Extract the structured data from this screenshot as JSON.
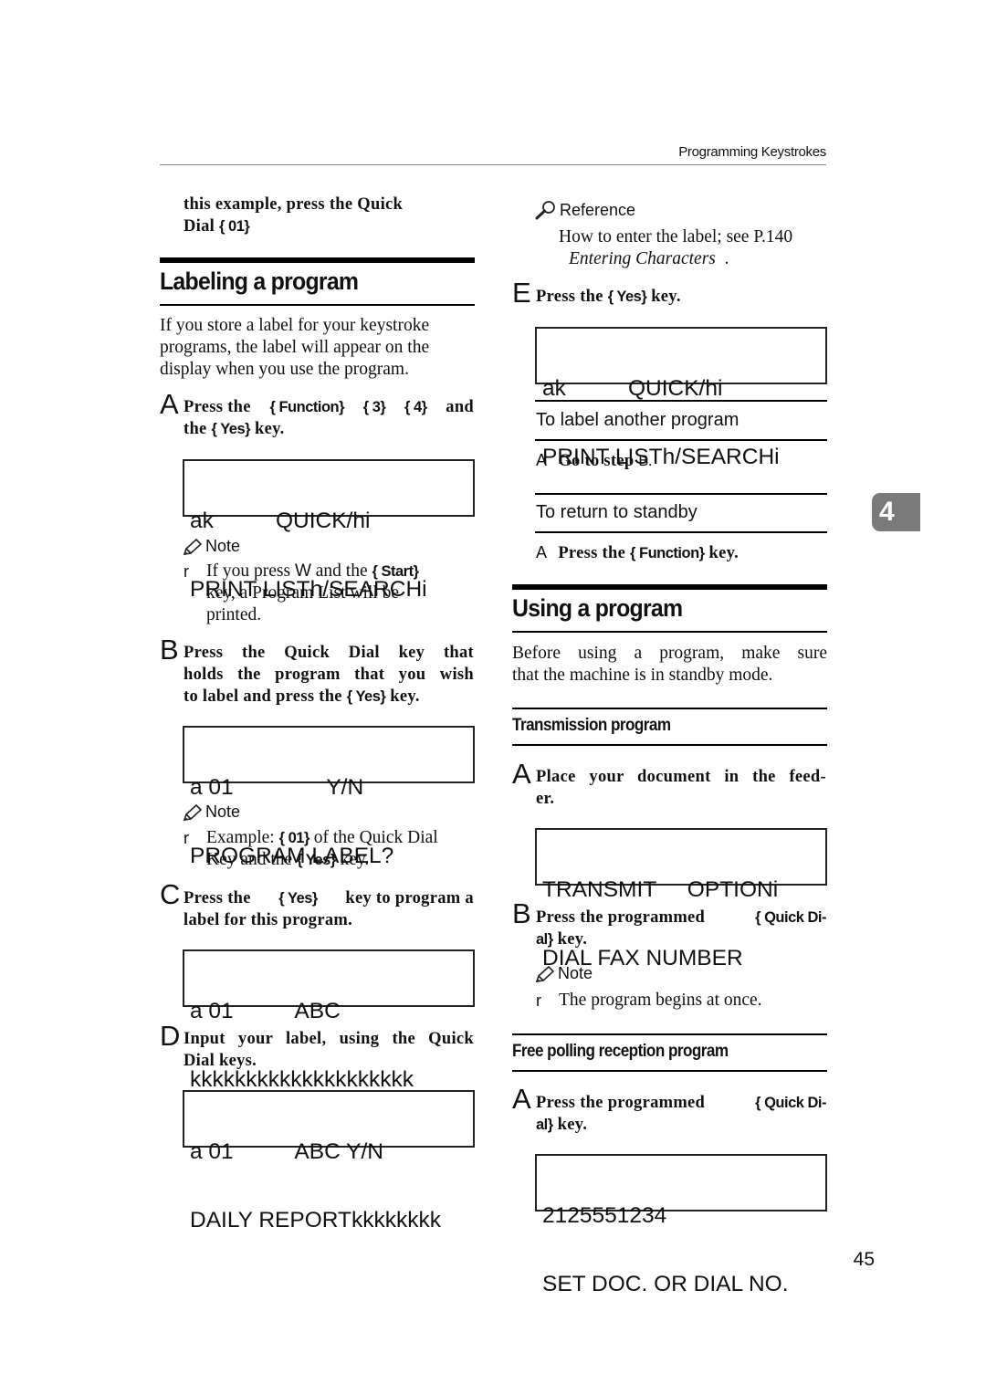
{
  "header": {
    "running_head": "Programming Keystrokes"
  },
  "left": {
    "intro": {
      "line1": "this example, press the Quick",
      "line2_prefix": "Dial ",
      "line2_key": "{ 01}"
    },
    "section_title": "Labeling a program",
    "section_body": [
      "If you store a label for your keystroke",
      "programs, the label will appear on the",
      "display when you use the program."
    ],
    "steps": [
      {
        "letter": "A",
        "parts": [
          "Press the ",
          "{ Function}",
          " ",
          "{ 3}",
          " ",
          "{ 4}",
          " and",
          "the ",
          "{ Yes}",
          " key."
        ],
        "display": [
          "ak          QUICK/hi",
          "PRINT LISTh/SEARCHi"
        ],
        "note": {
          "title": "Note",
          "bullet": "r",
          "lines": [
            "If you press ",
            "W",
            " and the ",
            "{ Start}",
            "key, a Program List will be",
            "printed."
          ]
        }
      },
      {
        "letter": "B",
        "lines": [
          "Press the Quick Dial key that",
          "holds the program that you wish",
          "to label and press the "
        ],
        "key": "{ Yes}",
        "tail": " key.",
        "display": [
          "a 01               Y/N",
          "PROGRAM LABEL?"
        ],
        "note": {
          "title": "Note",
          "bullet": "r",
          "line1_prefix": "Example: ",
          "line1_key": "{ 01}",
          "line1_suffix": " of the Quick Dial",
          "line2_prefix": "Key and the ",
          "line2_key": "{ Yes}",
          "line2_suffix": " key."
        }
      },
      {
        "letter": "C",
        "prefix": "Press the ",
        "key": "{ Yes}",
        "suffix": " key to program a",
        "line2": "label for this program.",
        "display": [
          "a 01          ABC",
          "kkkkkkkkkkkkkkkkkkkk"
        ]
      },
      {
        "letter": "D",
        "line1": "Input your label, using the Quick",
        "line2": "Dial keys.",
        "display": [
          "a 01          ABC Y/N",
          "DAILY REPORTkkkkkkkk"
        ]
      }
    ]
  },
  "right": {
    "reference": {
      "title": "Reference",
      "line1": "How to enter the label; see P.140",
      "line2_italic": "Entering Characters",
      "line2_tail": "  ."
    },
    "step_e": {
      "letter": "E",
      "prefix": "Press the ",
      "key": "{ Yes}",
      "suffix": " key.",
      "display": [
        "ak          QUICK/hi",
        "PRINT LISTh/SEARCHi"
      ]
    },
    "label_another": {
      "title": "To label another program",
      "bullet": "A",
      "text": "Go to step ",
      "ref": "B."
    },
    "return_standby": {
      "title": "To return to standby",
      "bullet": "A",
      "prefix": "Press the ",
      "key": "{ Function}",
      "suffix": " key."
    },
    "section_title": "Using a program",
    "section_body": [
      "Before using a program, make sure",
      "that the machine is in standby mode."
    ],
    "transmission": {
      "title": "Transmission program",
      "step_a": {
        "letter": "A",
        "line1": "Place your document in the feed-",
        "line2": "er.",
        "display": [
          "TRANSMIT     OPTIONi",
          "DIAL FAX NUMBER"
        ]
      },
      "step_b": {
        "letter": "B",
        "prefix": "Press the programmed ",
        "key1": "{ Quick Di-",
        "key2": "al}",
        "suffix": " key.",
        "note": {
          "title": "Note",
          "bullet": "r",
          "text": "The program begins at once."
        }
      }
    },
    "free_polling": {
      "title": "Free polling reception program",
      "step_a": {
        "letter": "A",
        "prefix": "Press the programmed ",
        "key1": "{ Quick Di-",
        "key2": "al}",
        "suffix": " key.",
        "display": [
          "2125551234",
          "SET DOC. OR DIAL NO."
        ]
      }
    }
  },
  "chapter_tab": "4",
  "page_number": "45"
}
